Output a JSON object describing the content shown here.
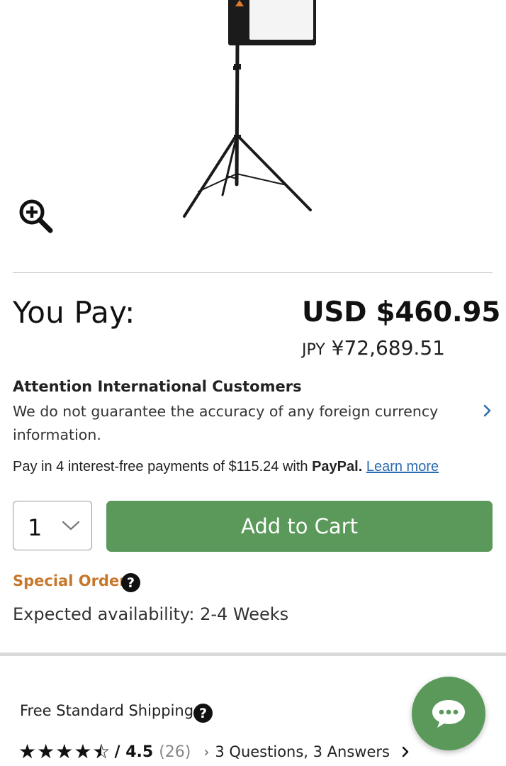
{
  "product": {
    "image_alt": "Softbox light on stand",
    "zoom_icon": "zoom-in-icon"
  },
  "pricing": {
    "you_pay_label": "You Pay:",
    "usd_price": "USD $460.95",
    "jpy_currency": "JPY",
    "jpy_amount": "¥72,689.51"
  },
  "international": {
    "title": "Attention International Customers",
    "body": "We do not guarantee the accuracy of any foreign currency information."
  },
  "paypal": {
    "prefix": "Pay in 4 interest-free payments of $115.24 with ",
    "brand": "PayPal.",
    "link": "Learn more"
  },
  "cart": {
    "quantity": "1",
    "add_label": "Add to Cart",
    "button_color": "#5a995a"
  },
  "availability": {
    "status": "Special Order",
    "status_color": "#c8772a",
    "expected": "Expected availability: 2-4 Weeks"
  },
  "shipping": {
    "label": "Free Standard Shipping"
  },
  "reviews": {
    "rating_display": "/ 4.5",
    "rating": 4.5,
    "count": "(26)",
    "qa": "3 Questions, 3 Answers"
  },
  "help_glyph": "?",
  "chat": {
    "icon": "chat-icon"
  }
}
